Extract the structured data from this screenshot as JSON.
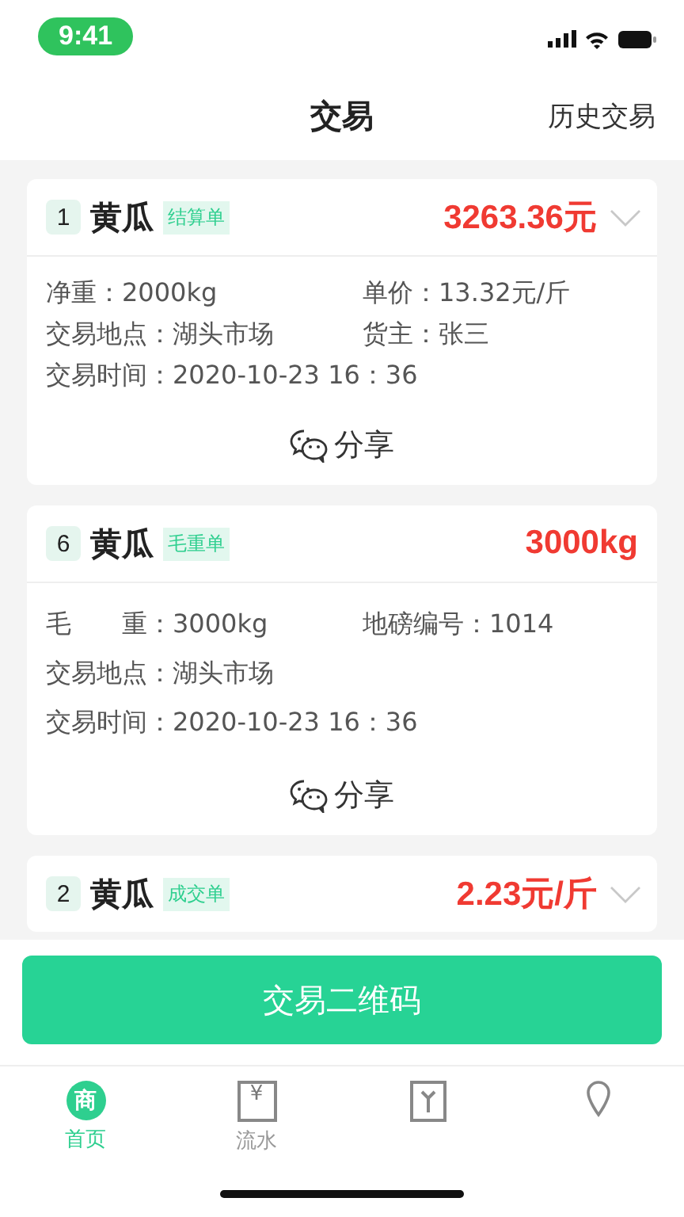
{
  "status_bar": {
    "time": "9:41"
  },
  "header": {
    "title": "交易",
    "action": "历史交易"
  },
  "records": [
    {
      "index": "1",
      "product": "黄瓜",
      "tag": "结算单",
      "amount": "3263.36元",
      "chevron": true,
      "rows": [
        [
          "净重：2000kg",
          "单价：13.32元/斤"
        ],
        [
          "交易地点：湖头市场",
          "货主：张三"
        ],
        [
          "交易时间：2020-10-23 16：36"
        ]
      ],
      "share": "分享"
    },
    {
      "index": "6",
      "product": "黄瓜",
      "tag": "毛重单",
      "amount": "3000kg",
      "chevron": false,
      "rows": [
        [
          "毛　　重：3000kg",
          "地磅编号：1014"
        ],
        [
          "交易地点：湖头市场"
        ],
        [
          "交易时间：2020-10-23 16：36"
        ]
      ],
      "share": "分享"
    },
    {
      "index": "2",
      "product": "黄瓜",
      "tag": "成交单",
      "amount": "2.23元/斤",
      "chevron": true
    }
  ],
  "qr_button": "交易二维码",
  "tabs": [
    {
      "kind": "shop",
      "glyph": "商",
      "label": "首页",
      "selected": true
    },
    {
      "kind": "ledger",
      "glyph": "¥",
      "label": "流水",
      "selected": false
    },
    {
      "kind": "sprout",
      "selected": false
    },
    {
      "kind": "pin",
      "selected": false
    }
  ]
}
